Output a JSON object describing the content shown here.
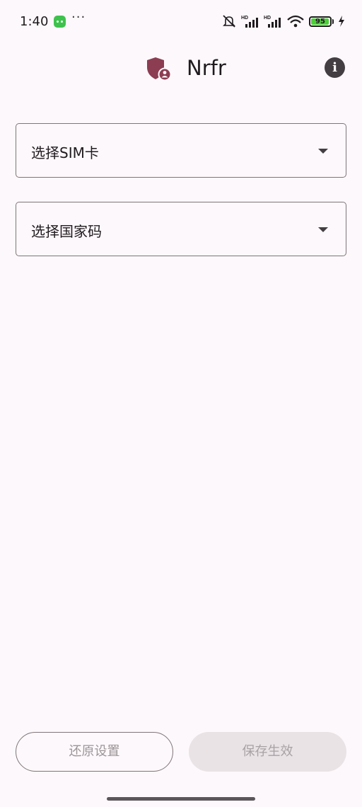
{
  "status_bar": {
    "time": "1:40",
    "more": "···",
    "battery_percent": "95",
    "icons": [
      "app-notification-icon",
      "mute-icon",
      "signal-hd-icon",
      "signal-hd-icon",
      "wifi-icon",
      "battery-icon",
      "charging-icon"
    ]
  },
  "app_bar": {
    "title": "Nrfr",
    "logo_icon": "shield-user-icon",
    "info_icon": "info-icon"
  },
  "form": {
    "sim_select": {
      "label": "选择SIM卡"
    },
    "country_select": {
      "label": "选择国家码"
    }
  },
  "actions": {
    "reset_label": "还原设置",
    "save_label": "保存生效"
  },
  "colors": {
    "background": "#fdf8fb",
    "logo": "#8c3d52",
    "outline": "#7f7579",
    "disabled_fill": "#e9e3e6"
  }
}
